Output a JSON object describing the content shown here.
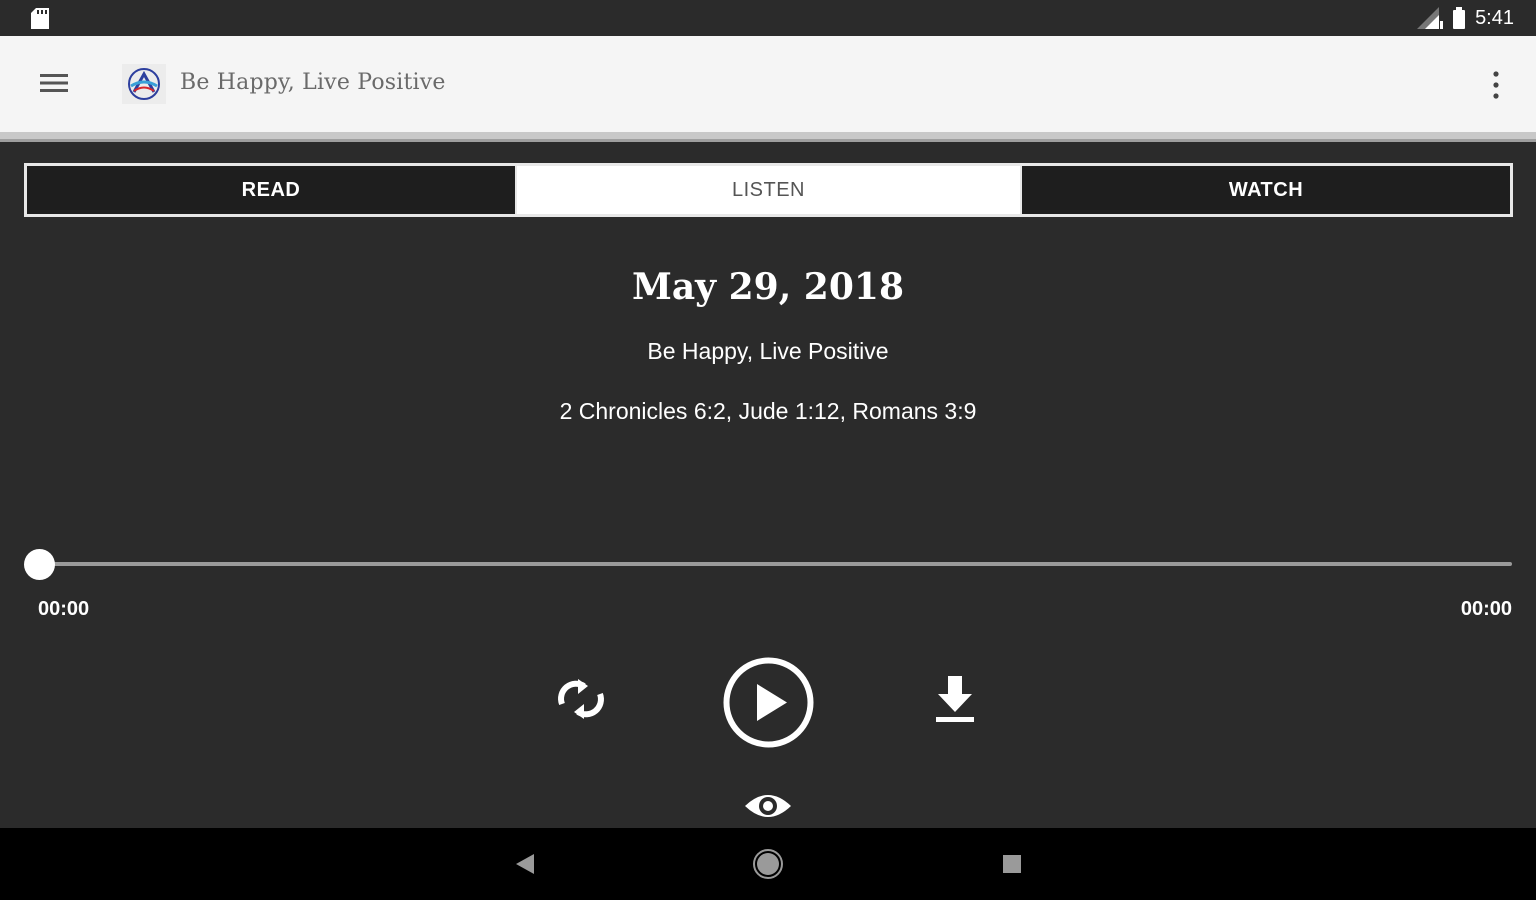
{
  "status_bar": {
    "time": "5:41",
    "icons": [
      "sd-card-icon",
      "signal-icon",
      "battery-icon"
    ]
  },
  "app_bar": {
    "title": "Be Happy, Live Positive",
    "icons": [
      "menu-icon",
      "logo-icon",
      "more-vert-icon"
    ],
    "background_color": "#f5f5f5",
    "title_color": "#6a6a6a"
  },
  "tabs": [
    {
      "label": "READ",
      "selected": false
    },
    {
      "label": "LISTEN",
      "selected": true
    },
    {
      "label": "WATCH",
      "selected": false
    }
  ],
  "content": {
    "date": "May 29, 2018",
    "title": "Be Happy, Live Positive",
    "scripture": "2 Chronicles 6:2, Jude 1:12, Romans 3:9"
  },
  "player": {
    "current_time": "00:00",
    "total_time": "00:00",
    "progress": 0,
    "controls": [
      "repeat-icon",
      "play-icon",
      "download-icon",
      "eye-icon"
    ]
  },
  "nav_bar": {
    "icons": [
      "back-icon",
      "home-icon",
      "recents-icon"
    ]
  },
  "colors": {
    "background": "#2b2b2b",
    "tab_selected_bg": "#ffffff",
    "tab_unselected_bg": "#1e1e1e",
    "seek_track": "#9a9a9a"
  }
}
